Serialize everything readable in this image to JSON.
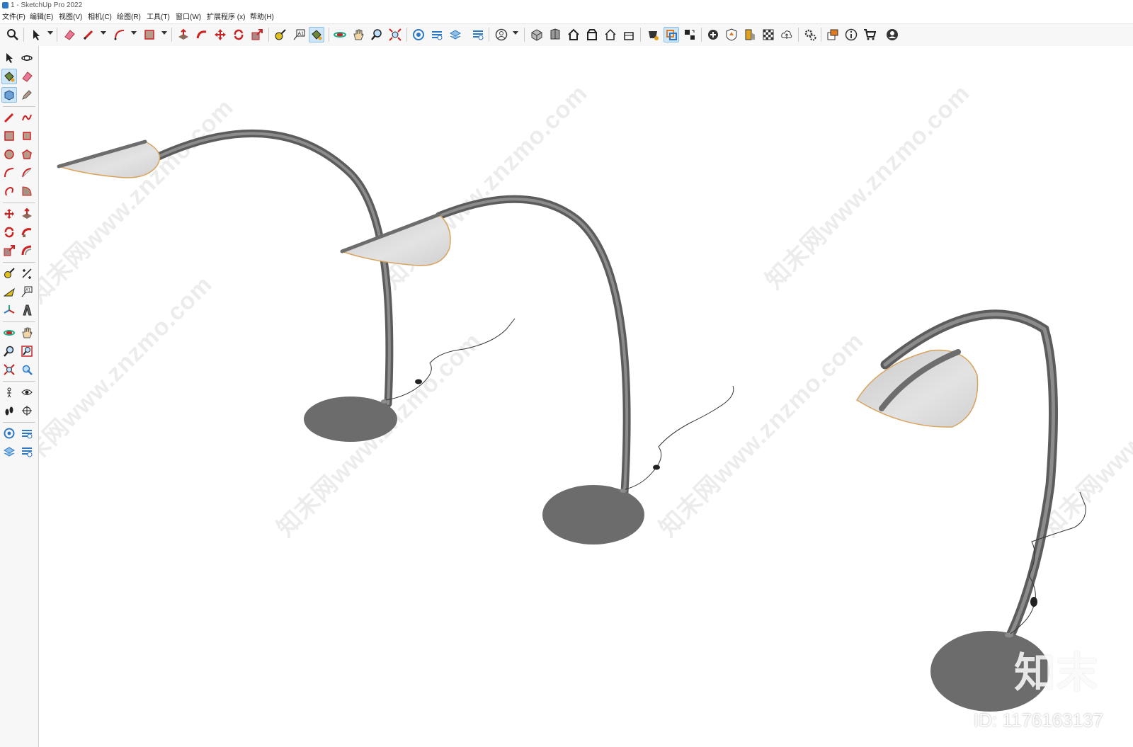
{
  "window": {
    "title": "1 - SketchUp Pro 2022"
  },
  "menu": [
    "文件(F)",
    "编辑(E)",
    "视图(V)",
    "相机(C)",
    "绘图(R)",
    "工具(T)",
    "窗口(W)",
    "扩展程序 (x)",
    "帮助(H)"
  ],
  "toolbar_icons": [
    "zoom-icon",
    "select-icon",
    "eraser-icon",
    "pencil-icon",
    "arc-icon",
    "rectangle-icon",
    "push-pull-icon",
    "follow-me-icon",
    "move-icon",
    "rotate-icon",
    "scale-icon",
    "tape-measure-icon",
    "text-icon",
    "paint-bucket-icon",
    "orbit-icon",
    "pan-icon",
    "zoom-tool-icon",
    "zoom-extents-icon",
    "warehouse-icon",
    "extension-warehouse-icon",
    "layout-icon",
    "styles-icon",
    "user-icon",
    "iso-view-icon",
    "top-view-icon",
    "front-view-icon",
    "right-view-icon",
    "back-view-icon",
    "left-view-icon",
    "solid-tools-icon",
    "section-plane-icon",
    "section-display-icon",
    "add-location-icon",
    "sandbox-icon",
    "shadows-icon",
    "fog-icon",
    "cloud-icon",
    "settings-icon",
    "scenes-icon",
    "info-icon",
    "cart-icon",
    "account-icon"
  ],
  "sidebar_icons": [
    "select-icon",
    "orbit-icon",
    "paint-bucket-icon",
    "eraser-icon",
    "component-icon",
    "tag-icon",
    "pencil-icon",
    "freehand-icon",
    "rectangle-icon",
    "rotated-rectangle-icon",
    "circle-icon",
    "polygon-icon",
    "arc-icon",
    "pie-icon",
    "two-point-arc-icon",
    "three-point-arc-icon",
    "move-icon",
    "push-pull-icon",
    "rotate-icon",
    "follow-me-icon",
    "scale-icon",
    "offset-icon",
    "tape-measure-icon",
    "dimension-icon",
    "protractor-icon",
    "text-icon",
    "axes-icon",
    "3d-text-icon",
    "orbit-tool-icon",
    "pan-icon",
    "zoom-icon",
    "zoom-window-icon",
    "zoom-extents-icon",
    "previous-view-icon",
    "position-camera-icon",
    "look-around-icon",
    "walk-icon",
    "section-plane-icon",
    "warehouse-icon",
    "extension-warehouse-icon",
    "layout-icon",
    "styles-icon"
  ],
  "viewport": {
    "watermark_text": "知末网www.znzmo.com",
    "brand_logo": "知末",
    "brand_id": "ID: 1176163137"
  },
  "colors": {
    "accent": "#2c78c4",
    "lamp_body": "#707070",
    "shade_rim": "#e2a45a",
    "toolbar_bg": "#f7f7f7"
  }
}
